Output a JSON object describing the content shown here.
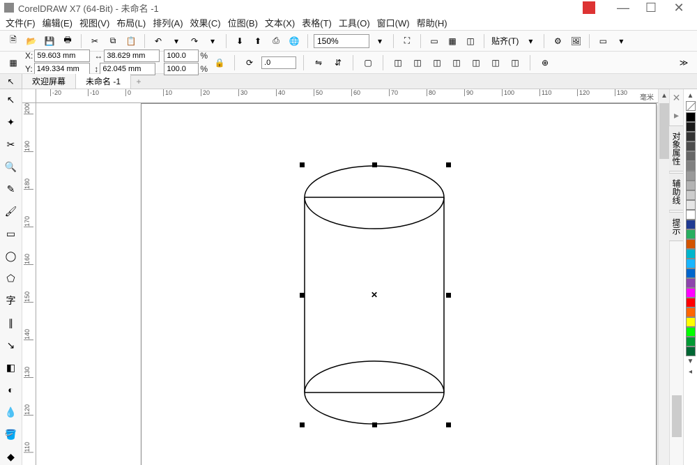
{
  "titlebar": {
    "title": "CorelDRAW X7 (64-Bit) - 未命名 -1"
  },
  "menus": [
    "文件(F)",
    "编辑(E)",
    "视图(V)",
    "布局(L)",
    "排列(A)",
    "效果(C)",
    "位图(B)",
    "文本(X)",
    "表格(T)",
    "工具(O)",
    "窗口(W)",
    "帮助(H)"
  ],
  "toolbar1": {
    "zoom": "150%",
    "align_label": "贴齐(T)"
  },
  "toolbar2": {
    "x_label": "X:",
    "y_label": "Y:",
    "x": "59.603 mm",
    "y": "149.334 mm",
    "w": "38.629 mm",
    "h": "62.045 mm",
    "scale_x": "100.0",
    "scale_y": "100.0",
    "percent": "%",
    "rotation": ".0"
  },
  "tabs": {
    "welcome": "欢迎屏幕",
    "doc": "未命名 -1"
  },
  "ruler": {
    "unit": "毫米",
    "h_ticks": [
      -20,
      -10,
      0,
      10,
      20,
      30,
      40,
      50,
      60,
      70,
      80,
      90,
      100,
      110,
      120,
      130
    ],
    "v_ticks": [
      200,
      190,
      180,
      170,
      160,
      150,
      140,
      130,
      120,
      110
    ]
  },
  "rightpanels": [
    "对象属性",
    "辅助线",
    "提示"
  ],
  "palette_swatches": [
    "#000000",
    "#1a1a1a",
    "#333333",
    "#4d4d4d",
    "#666666",
    "#808080",
    "#999999",
    "#b3b3b3",
    "#cccccc",
    "#e6e6e6",
    "#ffffff",
    "#1f3a93",
    "#27ae60",
    "#d35400",
    "#00b5cc",
    "#19b5fe",
    "#0066cc",
    "#8e44ad",
    "#ff00ff",
    "#ff0000",
    "#ff6600",
    "#ffff00",
    "#00ff00",
    "#009933",
    "#006633"
  ]
}
